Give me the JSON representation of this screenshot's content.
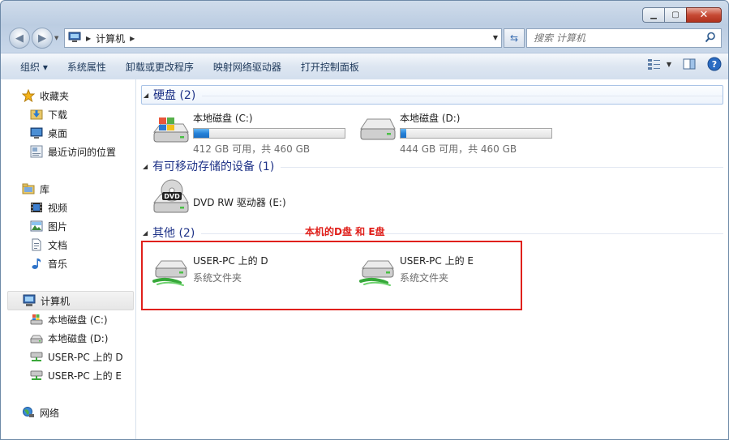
{
  "window": {
    "minimize_glyph": "▁",
    "maximize_glyph": "▢",
    "close_glyph": "✕"
  },
  "address": {
    "crumb": "计算机",
    "search_placeholder": "搜索 计算机"
  },
  "toolbar": {
    "organize": "组织 ▾",
    "system_properties": "系统属性",
    "uninstall": "卸载或更改程序",
    "map_drive": "映射网络驱动器",
    "control_panel": "打开控制面板"
  },
  "sidebar": {
    "favorites": "收藏夹",
    "downloads": "下载",
    "desktop": "桌面",
    "recent": "最近访问的位置",
    "libraries": "库",
    "videos": "视频",
    "pictures": "图片",
    "documents": "文档",
    "music": "音乐",
    "computer": "计算机",
    "drive_c": "本地磁盘 (C:)",
    "drive_d": "本地磁盘 (D:)",
    "share_d": "USER-PC 上的 D",
    "share_e": "USER-PC 上的 E",
    "network": "网络"
  },
  "groups": {
    "hard_disks": "硬盘 (2)",
    "removable": "有可移动存储的设备 (1)",
    "other": "其他 (2)"
  },
  "drives": {
    "c": {
      "name": "本地磁盘 (C:)",
      "free_text": "412 GB 可用，共 460 GB",
      "used_fraction": 0.104
    },
    "d": {
      "name": "本地磁盘 (D:)",
      "free_text": "444 GB 可用，共 460 GB",
      "used_fraction": 0.035
    },
    "dvd": {
      "name": "DVD RW 驱动器 (E:)",
      "label": "DVD"
    },
    "share_d": {
      "name": "USER-PC 上的 D",
      "sub": "系统文件夹"
    },
    "share_e": {
      "name": "USER-PC 上的 E",
      "sub": "系统文件夹"
    }
  },
  "annotation": "本机的D盘 和 E盘",
  "colors": {
    "accent_red": "#e0201b",
    "group_title": "#1e3287",
    "bar_fill": "#2682d8"
  }
}
